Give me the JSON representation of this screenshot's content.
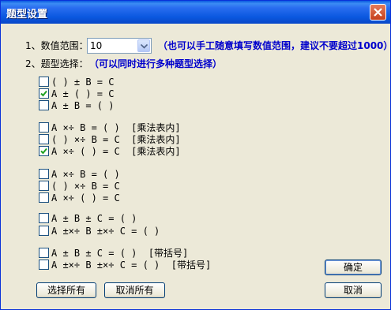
{
  "window": {
    "title": "题型设置"
  },
  "range": {
    "label": "1、数值范围：",
    "value": "10",
    "hint": "（也可以手工随意填写数值范围，建议不要超过1000）"
  },
  "types": {
    "label": "2、题型选择：",
    "hint": "（可以同时进行多种题型选择）",
    "options": [
      {
        "label": "( ) ± B = C",
        "checked": false
      },
      {
        "label": "A ± ( ) = C",
        "checked": true
      },
      {
        "label": "A ± B = ( )",
        "checked": false
      },
      {
        "label": "A ×÷ B = ( )  [乘法表内]",
        "checked": false
      },
      {
        "label": "( ) ×÷ B = C  [乘法表内]",
        "checked": false
      },
      {
        "label": "A ×÷ ( ) = C  [乘法表内]",
        "checked": true
      },
      {
        "label": "A ×÷ B = ( )",
        "checked": false
      },
      {
        "label": "( ) ×÷ B = C",
        "checked": false
      },
      {
        "label": "A ×÷ ( ) = C",
        "checked": false
      },
      {
        "label": "A ± B ± C = ( )",
        "checked": false
      },
      {
        "label": "A ±×÷ B ±×÷ C = ( )",
        "checked": false
      },
      {
        "label": "A ± B ± C = ( )  [带括号]",
        "checked": false
      },
      {
        "label": "A ±×÷ B ±×÷ C = ( )  [带括号]",
        "checked": false
      }
    ]
  },
  "buttons": {
    "ok": "确定",
    "select_all": "选择所有",
    "deselect_all": "取消所有",
    "cancel": "取消"
  }
}
